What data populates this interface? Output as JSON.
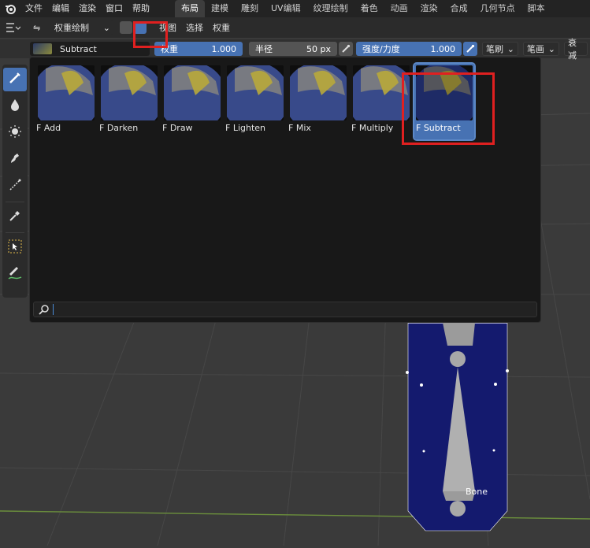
{
  "menu": [
    "文件",
    "编辑",
    "渲染",
    "窗口",
    "帮助"
  ],
  "workspace_tabs": [
    "布局",
    "建模",
    "雕刻",
    "UV编辑",
    "纹理绘制",
    "着色",
    "动画",
    "渲染",
    "合成",
    "几何节点",
    "脚本"
  ],
  "active_tab_index": 0,
  "header": {
    "mode_label": "权重绘制",
    "menus": [
      "视图",
      "选择",
      "权重"
    ]
  },
  "tool_settings": {
    "brush_name": "Subtract",
    "weight_label": "权重",
    "weight_value": "1.000",
    "radius_label": "半径",
    "radius_value": "50 px",
    "strength_label": "强度/力度",
    "strength_value": "1.000",
    "brush_dropdown": "笔刷",
    "stroke_dropdown": "笔画",
    "falloff_dropdown": "衰减"
  },
  "brushes": [
    {
      "label": "F Add",
      "selected": false
    },
    {
      "label": "F Darken",
      "selected": false
    },
    {
      "label": "F Draw",
      "selected": false
    },
    {
      "label": "F Lighten",
      "selected": false
    },
    {
      "label": "F Mix",
      "selected": false
    },
    {
      "label": "F Multiply",
      "selected": false
    },
    {
      "label": "F Subtract",
      "selected": true
    }
  ],
  "search": {
    "value": "",
    "placeholder": ""
  },
  "viewport": {
    "bone_label": "Bone"
  },
  "colors": {
    "accent": "#4772b3",
    "highlight": "#e02020"
  },
  "icons": [
    "blender-logo-icon",
    "mode-icon",
    "brush-icon",
    "drop-icon",
    "gradient-icon",
    "sample-weight-icon",
    "blur-icon",
    "eyedropper-icon",
    "select-box-icon",
    "annotate-icon",
    "search-icon"
  ]
}
